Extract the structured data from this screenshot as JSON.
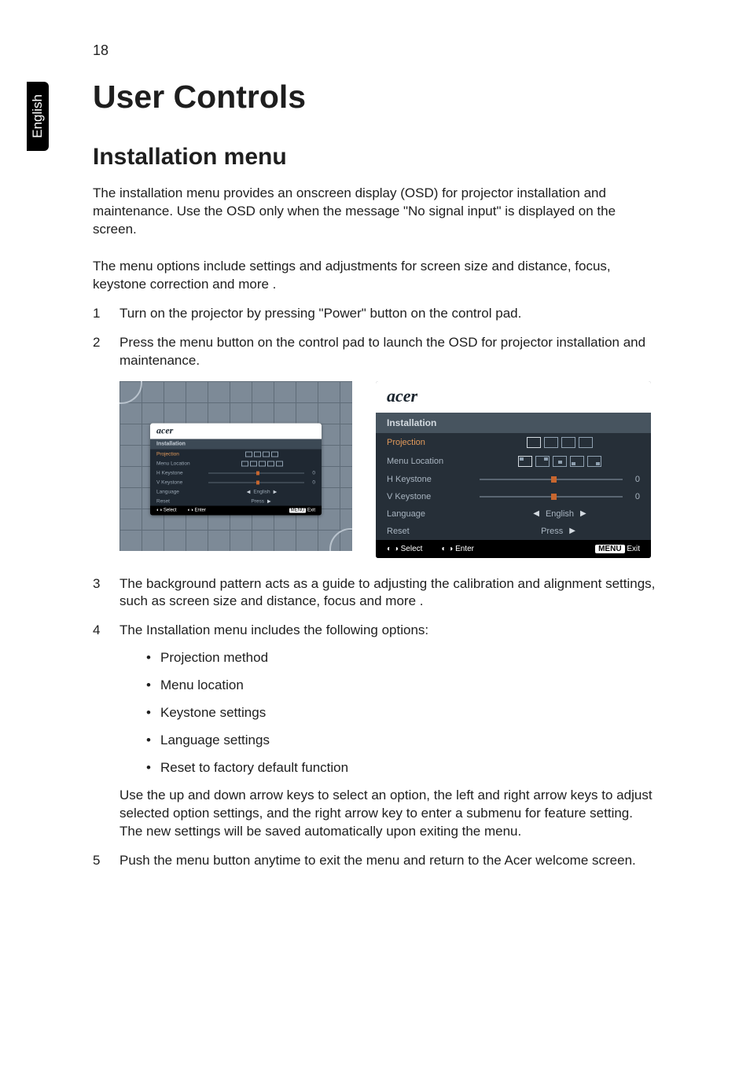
{
  "page_number": "18",
  "side_tab": "English",
  "h1": "User Controls",
  "h2": "Installation menu",
  "intro_p1": "The installation menu provides an onscreen display (OSD) for projector installation and maintenance. Use the OSD only when the message \"No signal input\" is displayed on the screen.",
  "intro_p2": "The menu options include settings and adjustments for screen size and distance, focus, keystone correction and more .",
  "steps": {
    "s1": "Turn on the projector by pressing \"Power\" button on the control pad.",
    "s2": "Press the menu button on the control pad to launch the OSD for projector installation and maintenance.",
    "s3": "The background pattern acts as a guide to adjusting the calibration and alignment settings, such as screen size and distance, focus and more .",
    "s4_intro": "The Installation menu includes the following options:",
    "s4_b1": "Projection method",
    "s4_b2": "Menu location",
    "s4_b3": "Keystone settings",
    "s4_b4": "Language settings",
    "s4_b5": "Reset to factory default function",
    "s4_text": "Use the up and down arrow keys to select an option, the left and right arrow keys to adjust selected option settings, and the right arrow key to enter a submenu for feature setting. The new settings will be saved automatically upon exiting the menu.",
    "s5": "Push the menu button anytime to exit the menu and return to the Acer welcome screen."
  },
  "numbers": {
    "n1": "1",
    "n2": "2",
    "n3": "3",
    "n4": "4",
    "n5": "5"
  },
  "osd": {
    "brand": "acer",
    "title": "Installation",
    "projection": "Projection",
    "menu_location": "Menu Location",
    "h_keystone": "H Keystone",
    "v_keystone": "V Keystone",
    "language": "Language",
    "reset": "Reset",
    "english": "English",
    "press": "Press",
    "zero": "0",
    "select": "Select",
    "enter": "Enter",
    "menu": "MENU",
    "exit": "Exit"
  }
}
